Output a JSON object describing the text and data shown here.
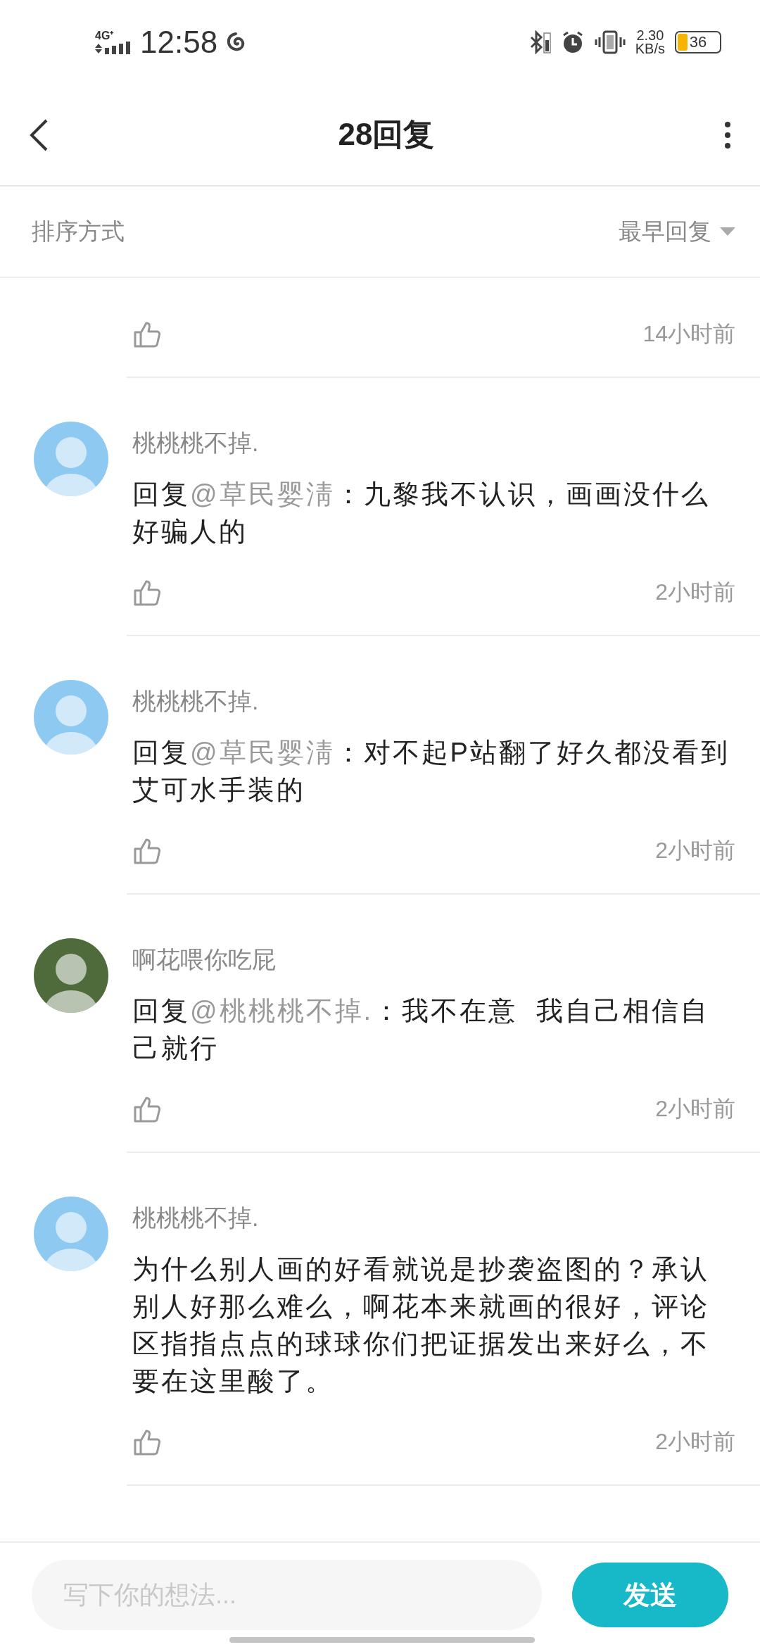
{
  "status_bar": {
    "network": "4G⁺",
    "time": "12:58",
    "speed_value": "2.30",
    "speed_unit": "KB/s",
    "battery": "36"
  },
  "header": {
    "title": "28回复"
  },
  "sort_bar": {
    "label": "排序方式",
    "value": "最早回复"
  },
  "top_fragment": {
    "time": "14小时前"
  },
  "comments": [
    {
      "name": "桃桃桃不掉.",
      "color": "#8ec9f2",
      "reply_prefix": "回复",
      "mention": "@草民婴淸",
      "text": "：九黎我不认识，画画没什么好骗人的",
      "time": "2小时前"
    },
    {
      "name": "桃桃桃不掉.",
      "color": "#8ec9f2",
      "reply_prefix": "回复",
      "mention": "@草民婴淸",
      "text": "：对不起P站翻了好久都没看到艾可水手装的",
      "time": "2小时前"
    },
    {
      "name": "啊花喂你吃屁",
      "color": "#4f6b3c",
      "reply_prefix": "回复",
      "mention": "@桃桃桃不掉.",
      "text": "：我不在意  我自己相信自己就行",
      "time": "2小时前"
    },
    {
      "name": "桃桃桃不掉.",
      "color": "#8ec9f2",
      "text": "为什么别人画的好看就说是抄袭盗图的？承认别人好那么难么，啊花本来就画的很好，评论区指指点点的球球你们把证据发出来好么，不要在这里酸了。",
      "time": "2小时前"
    }
  ],
  "composer": {
    "placeholder": "写下你的想法...",
    "send": "发送"
  }
}
